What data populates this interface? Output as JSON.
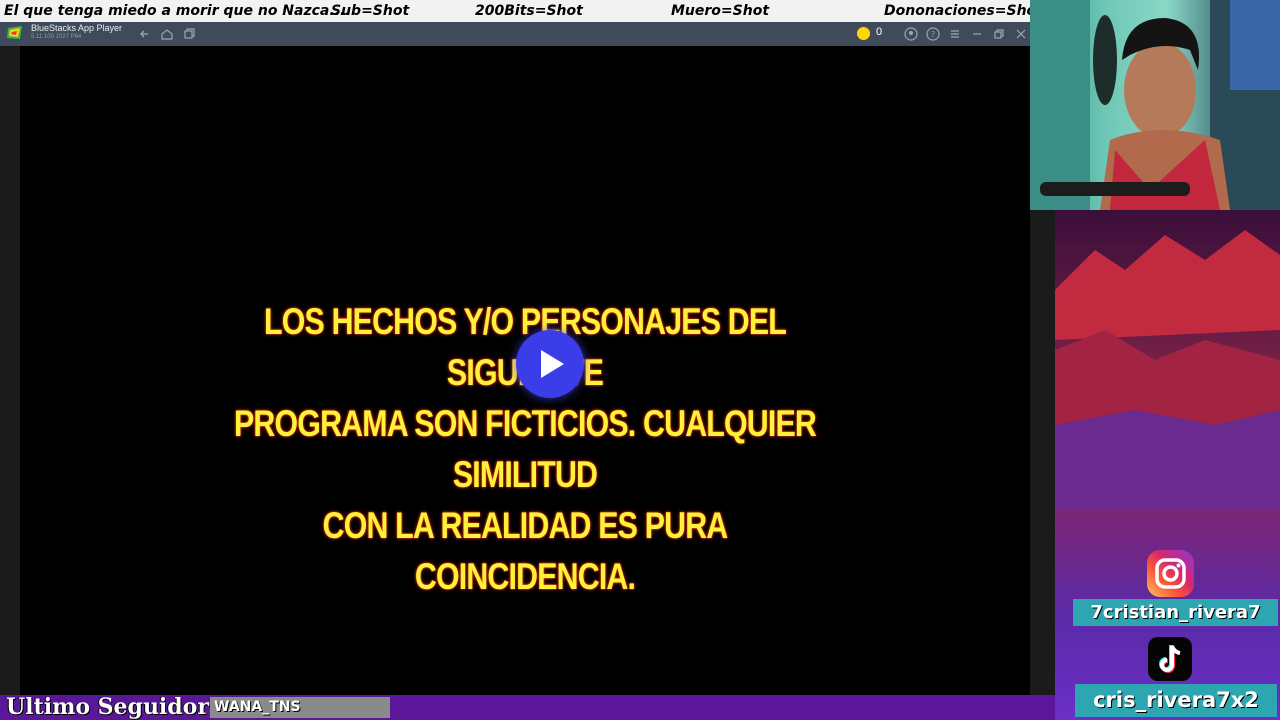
{
  "ticker": {
    "items": [
      "El que tenga miedo a morir que no Nazca....",
      "Sub=Shot",
      "200Bits=Shot",
      "Muero=Shot",
      "Dononaciones=Shot"
    ]
  },
  "bluestacks": {
    "title": "BlueStacks App Player",
    "subtitle": "5.11.100.1027 P64",
    "coin_count": "0"
  },
  "video": {
    "disclaimer_lines": [
      "LOS HECHOS Y/O PERSONAJES DEL SIGUIENTE",
      "PROGRAMA SON FICTICIOS. CUALQUIER SIMILITUD",
      "CON LA REALIDAD ES PURA COINCIDENCIA."
    ]
  },
  "socials": {
    "instagram": "7cristian_rivera7",
    "tiktok": "cris_rivera7x2"
  },
  "footer": {
    "label": "Ultimo Seguidor",
    "follower": "WANA_TNS"
  },
  "colors": {
    "ticker_bg": "#f2f2f2",
    "titlebar": "#3f4b5a",
    "disclaimer_text": "#fff23a",
    "play_button": "#3b3ee8",
    "social_label_bg": "#2ea6b2",
    "bottom_bar": "#5b179a"
  },
  "icons": [
    "bluestacks-logo-icon",
    "back-icon",
    "home-icon",
    "multi-instance-icon",
    "coin-icon",
    "account-icon",
    "help-icon",
    "menu-icon",
    "minimize-icon",
    "restore-icon",
    "close-icon",
    "play-icon",
    "instagram-icon",
    "tiktok-icon"
  ]
}
